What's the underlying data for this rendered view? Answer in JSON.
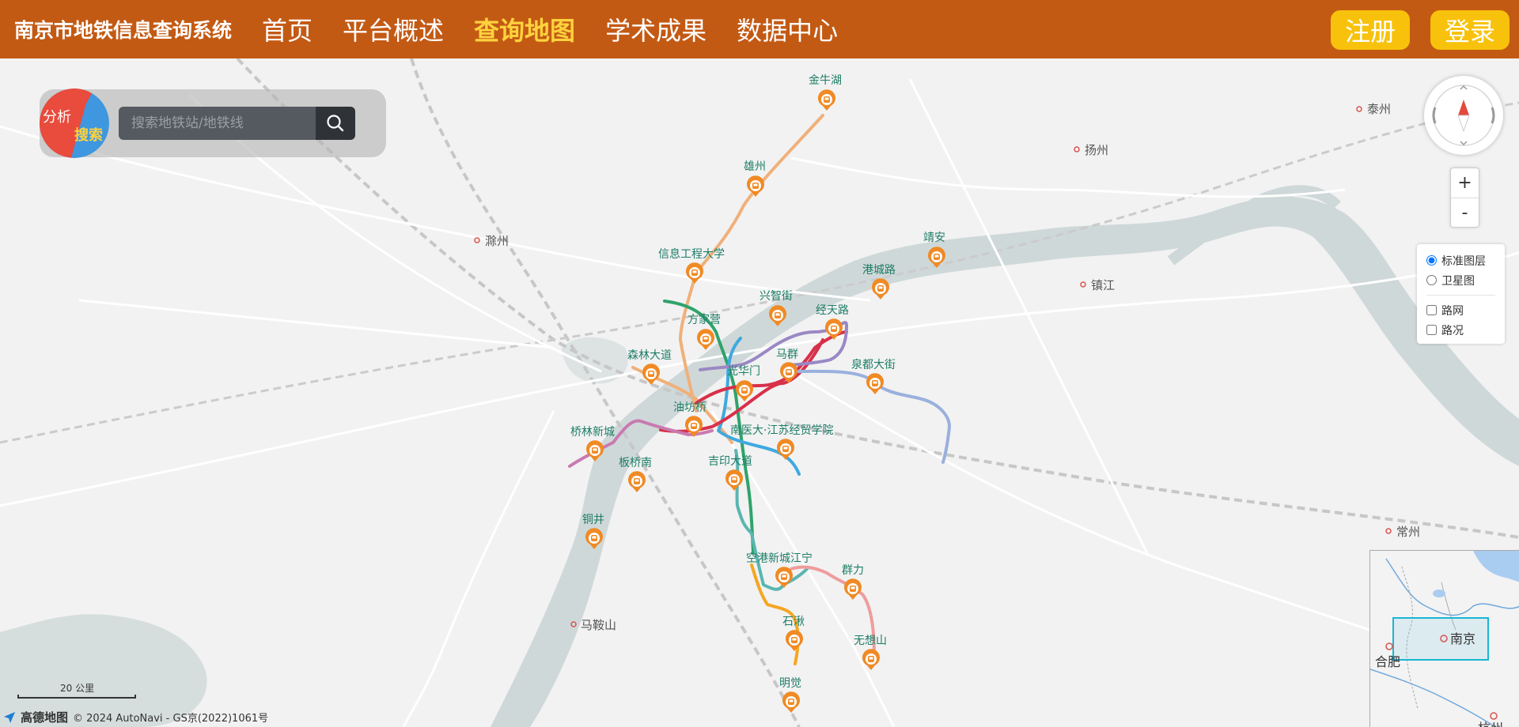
{
  "header": {
    "brand": "南京市地铁信息查询系统",
    "nav": [
      {
        "label": "首页",
        "active": false
      },
      {
        "label": "平台概述",
        "active": false
      },
      {
        "label": "查询地图",
        "active": true
      },
      {
        "label": "学术成果",
        "active": false
      },
      {
        "label": "数据中心",
        "active": false
      }
    ],
    "register_label": "注册",
    "login_label": "登录"
  },
  "search": {
    "analysis_label": "分析",
    "search_label": "搜索",
    "placeholder": "搜索地铁站/地铁线"
  },
  "map_controls": {
    "zoom_in": "+",
    "zoom_out": "-",
    "layers": {
      "base_options": [
        {
          "label": "标准图层",
          "checked": true
        },
        {
          "label": "卫星图",
          "checked": false
        }
      ],
      "overlay_options": [
        {
          "label": "路网",
          "checked": false
        },
        {
          "label": "路况",
          "checked": false
        }
      ]
    }
  },
  "cities": [
    "泰州",
    "扬州",
    "滁州",
    "镇江",
    "常州",
    "马鞍山"
  ],
  "stations": [
    "金牛湖",
    "雄州",
    "信息工程大学",
    "靖安",
    "港城路",
    "兴智街",
    "经天路",
    "方家营",
    "森林大道",
    "马群",
    "光华门",
    "泉都大街",
    "油坊桥",
    "桥林新城",
    "南医大·江苏经贸学院",
    "板桥南",
    "吉印大道",
    "铜井",
    "空港新城江宁",
    "群力",
    "石湫",
    "无想山",
    "明觉"
  ],
  "overview": {
    "cities": [
      "南京",
      "合肥",
      "杭州"
    ]
  },
  "scale_label": "20 公里",
  "footer": {
    "logo_text": "高德地图",
    "copyright": "© 2024 AutoNavi - GS京(2022)1061号"
  },
  "colors": {
    "header_bg": "#c35a14",
    "nav_active": "#ffd23d",
    "auth_btn": "#f8c20c",
    "station_marker": "#f08a24"
  }
}
